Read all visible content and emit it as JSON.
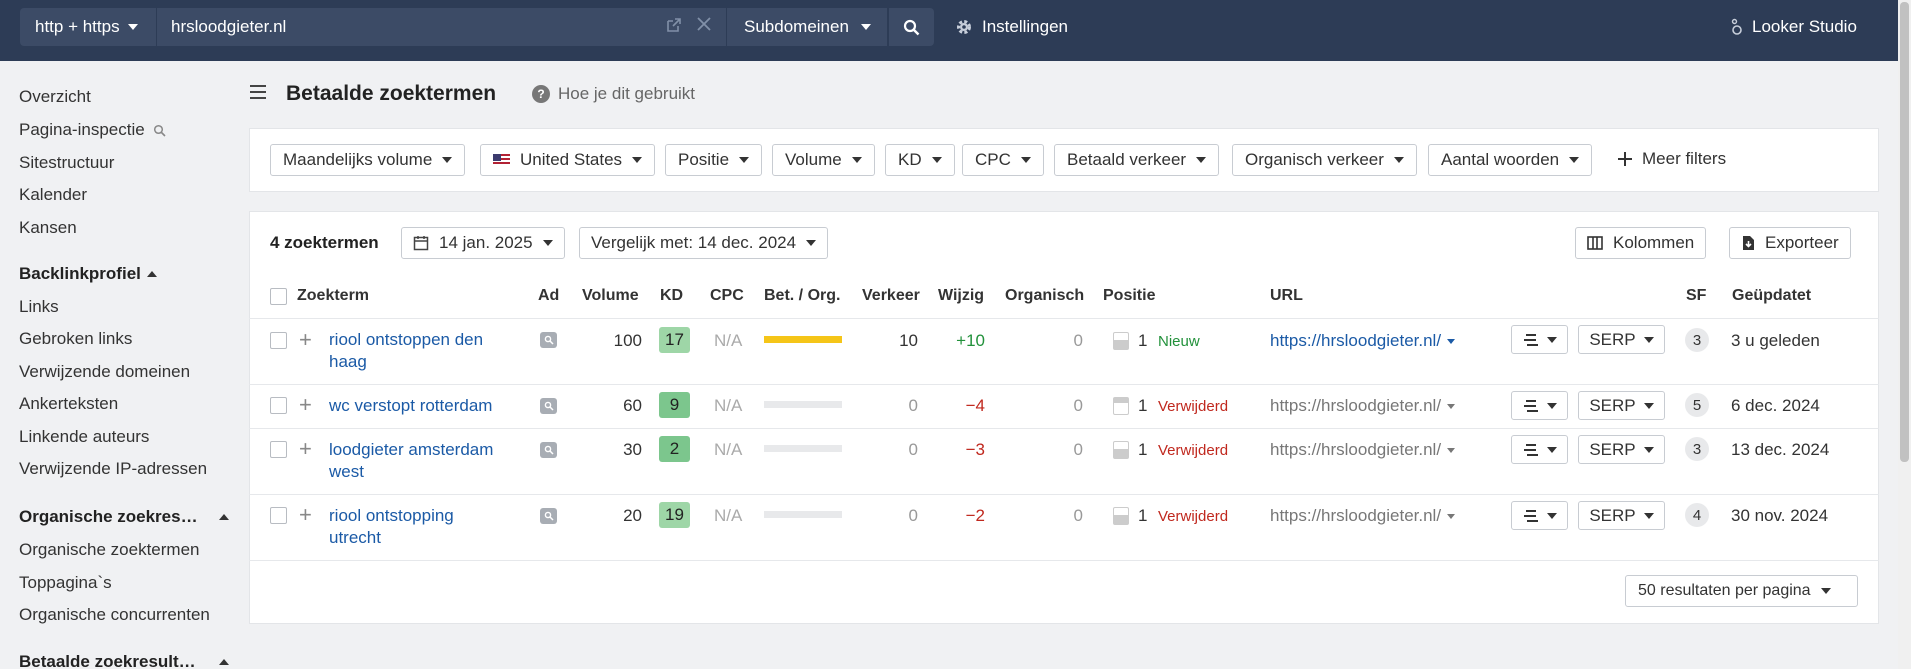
{
  "topbar": {
    "protocol": "http + https",
    "url_value": "hrsloodgieter.nl",
    "mode": "Subdomeinen",
    "settings_label": "Instellingen",
    "looker_label": "Looker Studio"
  },
  "sidebar": {
    "items_top": [
      "Overzicht",
      "Pagina-inspectie",
      "Sitestructuur",
      "Kalender",
      "Kansen"
    ],
    "backlink_head": "Backlinkprofiel",
    "backlink_items": [
      "Links",
      "Gebroken links",
      "Verwijzende domeinen",
      "Ankerteksten",
      "Linkende auteurs",
      "Verwijzende IP-adressen"
    ],
    "organic_head": "Organische zoekres…",
    "organic_items": [
      "Organische zoektermen",
      "Toppagina`s",
      "Organische concurrenten"
    ],
    "paid_head": "Betaalde zoekresult…"
  },
  "page": {
    "title": "Betaalde zoektermen",
    "help": "Hoe je dit gebruikt"
  },
  "filters": {
    "monthly_volume": "Maandelijks volume",
    "country": "United States",
    "position": "Positie",
    "volume": "Volume",
    "kd": "KD",
    "cpc": "CPC",
    "paid_traffic": "Betaald verkeer",
    "organic_traffic": "Organisch verkeer",
    "word_count": "Aantal woorden",
    "more": "Meer filters"
  },
  "table": {
    "count": "4 zoektermen",
    "date": "14 jan. 2025",
    "compare": "Vergelijk met: 14 dec. 2024",
    "columns_btn": "Kolommen",
    "export_btn": "Exporteer",
    "headers": {
      "keyword": "Zoekterm",
      "ad": "Ad",
      "volume": "Volume",
      "kd": "KD",
      "cpc": "CPC",
      "paid_org": "Bet. / Org.",
      "traffic": "Verkeer",
      "change": "Wijzig",
      "organic": "Organisch",
      "position": "Positie",
      "url": "URL",
      "sf": "SF",
      "updated": "Geüpdatet"
    },
    "rows": [
      {
        "keyword": "riool ontstoppen den haag",
        "volume": "100",
        "kd": "17",
        "cpc": "N/A",
        "paid_share": 1.0,
        "traffic": "10",
        "change": "+10",
        "organic": "0",
        "position": "1",
        "pos_status": "Nieuw",
        "url": "https://hrsloodgieter.nl/",
        "serp": "SERP",
        "sf": "3",
        "updated": "3 u geleden"
      },
      {
        "keyword": "wc verstopt rotterdam",
        "volume": "60",
        "kd": "9",
        "cpc": "N/A",
        "paid_share": 0,
        "traffic": "0",
        "change": "−4",
        "organic": "0",
        "position": "1",
        "pos_status": "Verwijderd",
        "url": "https://hrsloodgieter.nl/",
        "serp": "SERP",
        "sf": "5",
        "updated": "6 dec. 2024"
      },
      {
        "keyword": "loodgieter amsterdam west",
        "volume": "30",
        "kd": "2",
        "cpc": "N/A",
        "paid_share": 0,
        "traffic": "0",
        "change": "−3",
        "organic": "0",
        "position": "1",
        "pos_status": "Verwijderd",
        "url": "https://hrsloodgieter.nl/",
        "serp": "SERP",
        "sf": "3",
        "updated": "13 dec. 2024"
      },
      {
        "keyword": "riool ontstopping utrecht",
        "volume": "20",
        "kd": "19",
        "cpc": "N/A",
        "paid_share": 0,
        "traffic": "0",
        "change": "−2",
        "organic": "0",
        "position": "1",
        "pos_status": "Verwijderd",
        "url": "https://hrsloodgieter.nl/",
        "serp": "SERP",
        "sf": "4",
        "updated": "30 nov. 2024"
      }
    ],
    "per_page": "50 resultaten per pagina"
  },
  "colors": {
    "topbar": "#2d3c56",
    "link": "#1b5aa6",
    "positive": "#22913b",
    "negative": "#c0281e",
    "paid_bar": "#f5c518"
  }
}
